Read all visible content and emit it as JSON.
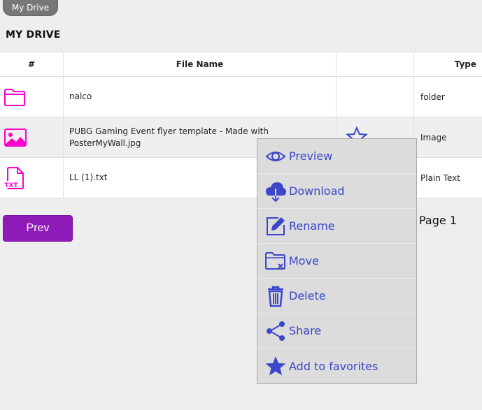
{
  "breadcrumb": {
    "label": "My Drive"
  },
  "page": {
    "title": "MY DRIVE",
    "page_label": "Page 1",
    "prev_label": "Prev"
  },
  "table": {
    "headers": {
      "num": "#",
      "name": "File Name",
      "star": "",
      "type": "Type"
    },
    "rows": [
      {
        "icon": "folder-icon",
        "name": "nalco",
        "type": "folder"
      },
      {
        "icon": "image-icon",
        "name": "PUBG Gaming Event flyer template - Made with PosterMyWall.jpg",
        "type": "Image"
      },
      {
        "icon": "txt-file-icon",
        "name": "LL (1).txt",
        "type": "Plain Text"
      }
    ]
  },
  "context_menu": {
    "items": [
      {
        "label": "Preview",
        "icon": "eye-icon"
      },
      {
        "label": "Download",
        "icon": "cloud-download-icon"
      },
      {
        "label": "Rename",
        "icon": "edit-icon"
      },
      {
        "label": "Move",
        "icon": "folder-move-icon"
      },
      {
        "label": "Delete",
        "icon": "trash-icon"
      },
      {
        "label": "Share",
        "icon": "share-icon"
      },
      {
        "label": "Add to favorites",
        "icon": "star-icon"
      }
    ]
  },
  "colors": {
    "accent": "#8e1bb8",
    "file_icon": "#ff00cc",
    "menu_text": "#3c46c8"
  }
}
